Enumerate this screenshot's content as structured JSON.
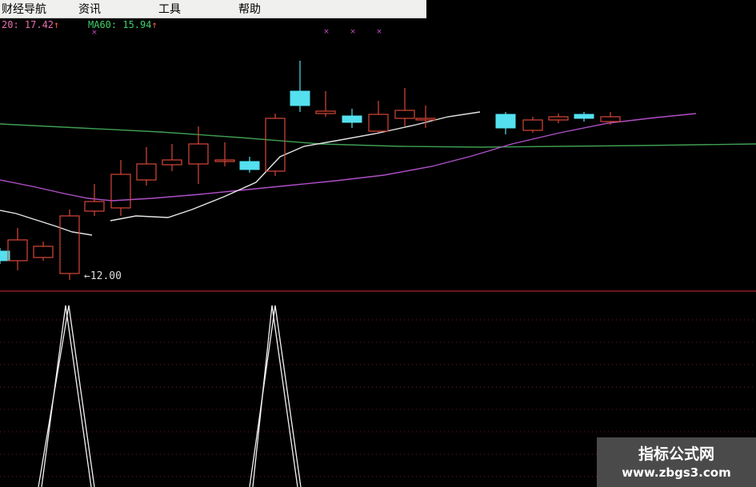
{
  "menu": {
    "items": [
      "财经导航",
      "资讯",
      "工具",
      "帮助"
    ]
  },
  "indicators": {
    "ma20_text": "20: 17.42",
    "ma60_text": "MA60: 15.94",
    "up_arrow": "↑",
    "ma20_color": "#e86fb0",
    "ma60_color": "#3fcf6a",
    "arrow_color": "#ff5a3a"
  },
  "price_label": "12.00",
  "colors": {
    "up_candle": "#d8453a",
    "down_candle": "#54e0ef",
    "ma_fast": "#e6e6e6",
    "ma_mid": "#b150c8",
    "ma_slow": "#3f9e52",
    "divider": "#8b1f28",
    "grid_dots": "#7a1a1a",
    "lower_indicator": "#f2f2f2",
    "cross_marks": "#c850c8"
  },
  "watermark": {
    "brand": "指标公式网",
    "url": "www.zbgs3.com"
  }
}
